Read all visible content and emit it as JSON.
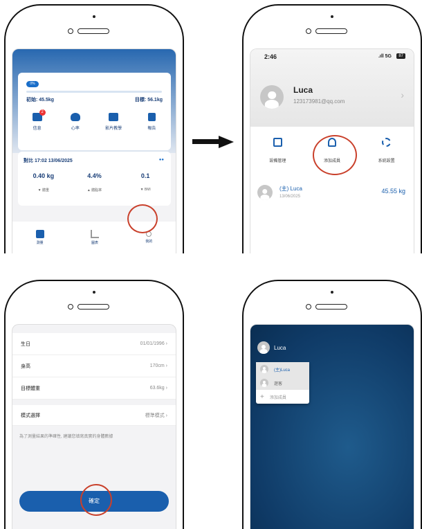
{
  "arrow": "right-arrow",
  "panel1": {
    "progress_badge": "0%",
    "initial_label": "初始: 45.5kg",
    "target_label": "目標: 56.1kg",
    "icons": [
      {
        "label": "信息",
        "badge": "2",
        "icon": "mail-icon"
      },
      {
        "label": "心率",
        "icon": "heart-rate-icon"
      },
      {
        "label": "影片教學",
        "icon": "video-icon"
      },
      {
        "label": "報告",
        "icon": "report-icon"
      }
    ],
    "compare_label": "對比 17:02 13/06/2025",
    "stats": [
      {
        "value": "0.40 kg",
        "label": "▼ 體重"
      },
      {
        "value": "4.4%",
        "label": "▲ 體脂率"
      },
      {
        "value": "0.1",
        "label": "▼ BMI"
      }
    ],
    "tabs": [
      "測量",
      "圖表",
      "我的"
    ]
  },
  "panel2": {
    "time": "2:46",
    "status": ".ıll 5G",
    "battery": "87",
    "user_name": "Luca",
    "user_email": "123173981@qq.com",
    "actions": [
      "設備管理",
      "添加成員",
      "系統設置"
    ],
    "member_name": "(主) Luca",
    "member_date": "13/06/2025",
    "member_weight": "45.55 kg"
  },
  "panel3": {
    "rows": [
      {
        "label": "生日",
        "value": "01/01/1996"
      },
      {
        "label": "身高",
        "value": "170cm"
      },
      {
        "label": "目標體重",
        "value": "63.6kg"
      }
    ],
    "mode_label": "模式選擇",
    "mode_value": "標準模式",
    "hint": "為了測量結果的準確性, 建議您填寫真實的身體數據",
    "confirm": "確定"
  },
  "panel4": {
    "user_name": "Luca",
    "menu": [
      "(主)Luca",
      "遊客",
      "添加成員"
    ]
  }
}
